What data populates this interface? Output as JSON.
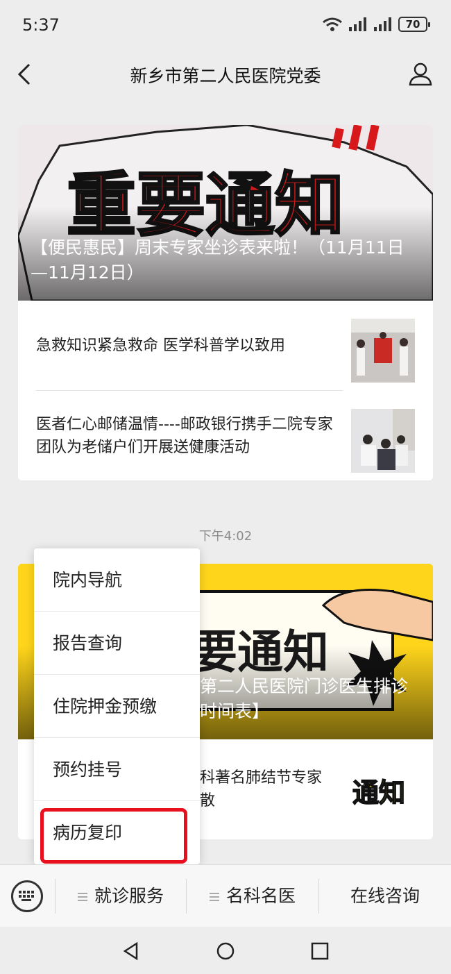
{
  "status_bar": {
    "time": "5:37",
    "battery": "70"
  },
  "nav": {
    "title": "新乡市第二人民医院党委"
  },
  "cards": [
    {
      "hero_title": "【便民惠民】周末专家坐诊表来啦！（11月11日—11月12日）",
      "hero_banner_text": "重要通知",
      "articles": [
        {
          "title": "急救知识紧急救命 医学科普学以致用"
        },
        {
          "title": "医者仁心邮储温情----邮政银行携手二院专家团队为老储户们开展送健康活动"
        }
      ]
    },
    {
      "hero_title": "第二人民医院门诊医生排诊时间表】",
      "hero_banner_text": "要通知",
      "articles": [
        {
          "title": "科著名肺结节专家\n散"
        }
      ]
    }
  ],
  "timestamp": "下午4:02",
  "popup_menu": [
    {
      "label": "院内导航"
    },
    {
      "label": "报告查询"
    },
    {
      "label": "住院押金预缴"
    },
    {
      "label": "预约挂号"
    },
    {
      "label": "病历复印"
    }
  ],
  "bottom_menu": [
    {
      "label": "就诊服务",
      "has_submenu": true
    },
    {
      "label": "名科名医",
      "has_submenu": true
    },
    {
      "label": "在线咨询",
      "has_submenu": false
    }
  ],
  "thumb_text": "通知",
  "colors": {
    "highlight": "#e8101f",
    "banner_red": "#d8191c",
    "banner_yellow": "#ffd51b"
  }
}
